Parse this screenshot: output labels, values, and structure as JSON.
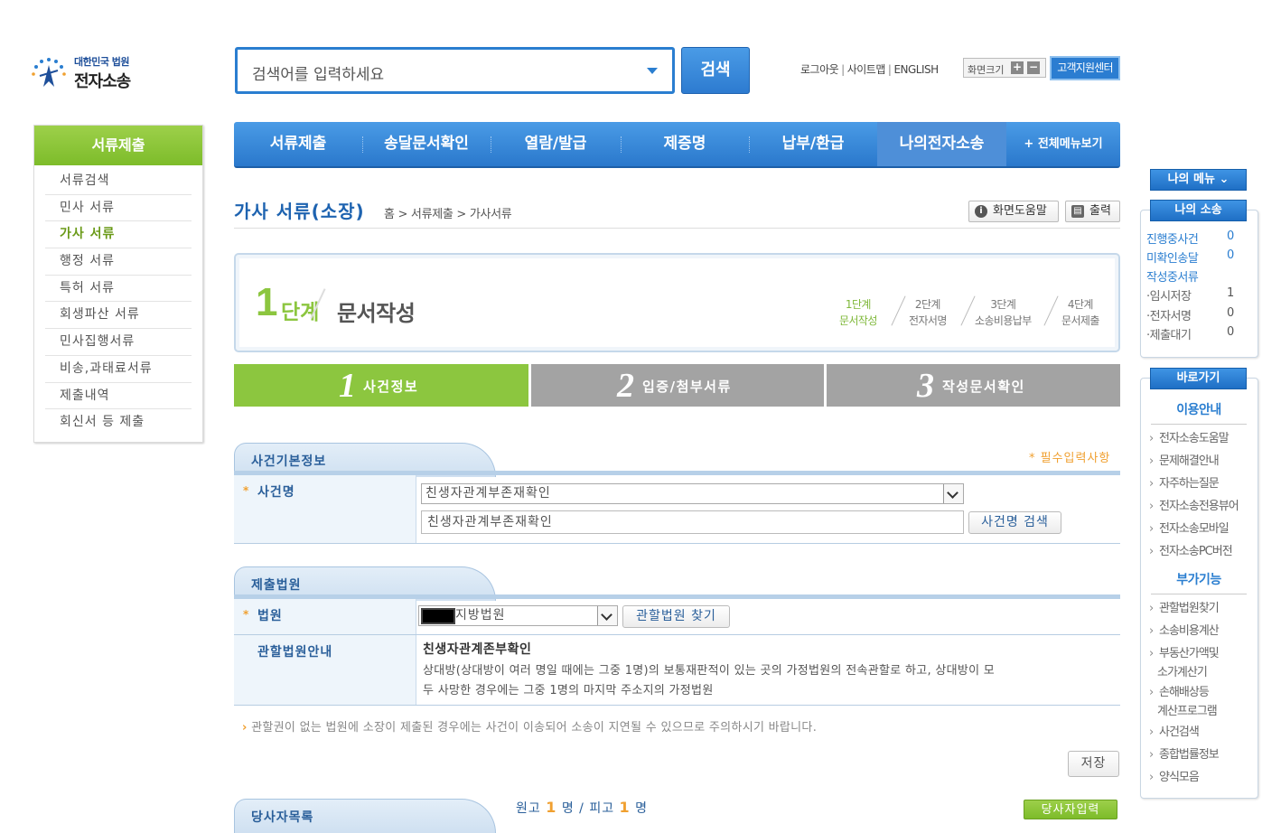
{
  "logo": {
    "line1": "대한민국 법원",
    "line2": "전자소송"
  },
  "search": {
    "placeholder": "검색어를 입력하세요",
    "button": "검색"
  },
  "top_links": {
    "logout": "로그아웃",
    "sitemap": "사이트맵",
    "english": "ENGLISH",
    "zoom_label": "화면크기",
    "zoom_in": "+",
    "zoom_out": "−",
    "customer_center": "고객지원센터"
  },
  "left_menu": {
    "title": "서류제출",
    "items": [
      "서류검색",
      "민사 서류",
      "가사 서류",
      "행정 서류",
      "특허 서류",
      "회생파산 서류",
      "민사집행서류",
      "비송,과태료서류",
      "제출내역",
      "회신서 등 제출"
    ],
    "active_index": 2
  },
  "main_nav": {
    "tabs": [
      "서류제출",
      "송달문서확인",
      "열람/발급",
      "제증명",
      "납부/환급",
      "나의전자소송"
    ],
    "active_index": 5,
    "all_menu": "+ 전체메뉴보기"
  },
  "page": {
    "title": "가사 서류(소장)",
    "breadcrumb": "홈 > 서류제출 > 가사서류",
    "help_button": "화면도움말",
    "print_button": "출력"
  },
  "step_box": {
    "current_num": "1",
    "current_unit": "단계",
    "current_name": "문서작성",
    "steps": [
      {
        "l1": "1단계",
        "l2": "문서작성"
      },
      {
        "l1": "2단계",
        "l2": "전자서명"
      },
      {
        "l1": "3단계",
        "l2": "소송비용납부"
      },
      {
        "l1": "4단계",
        "l2": "문서제출"
      }
    ]
  },
  "wizard_tabs": [
    {
      "num": "1",
      "label": "사건정보",
      "color": "#8cc63f"
    },
    {
      "num": "2",
      "label": "입증/첨부서류",
      "color": "#a3a3a3"
    },
    {
      "num": "3",
      "label": "작성문서확인",
      "color": "#a3a3a3"
    }
  ],
  "case_info": {
    "section_title": "사건기본정보",
    "required_note": "* 필수입력사항",
    "case_name_label": "사건명",
    "case_name_select": "친생자관계부존재확인",
    "case_name_input": "친생자관계부존재확인",
    "case_search_button": "사건명 검색"
  },
  "court": {
    "section_title": "제출법원",
    "court_label": "법원",
    "court_select_suffix": "지방법원",
    "find_button": "관할법원 찾기",
    "guide_label": "관할법원안내",
    "guide_title": "친생자관계존부확인",
    "guide_text_1": "상대방(상대방이 여러 명일 때에는 그중 1명)의 보통재판적이 있는 곳의 가정법원의 전속관할로 하고, 상대방이 모",
    "guide_text_2": "두 사망한 경우에는 그중 1명의 마지막 주소지의 가정법원"
  },
  "notice": "관할권이 없는 법원에 소장이 제출된 경우에는 사건이 이송되어 소송이 지연될 수 있으므로 주의하시기 바랍니다.",
  "save_button": "저장",
  "parties": {
    "section_title": "당사자목록",
    "plaintiff_label": "원고",
    "plaintiff_count": "1",
    "defendant_label": "피고",
    "defendant_count": "1",
    "unit": "명",
    "input_button": "당사자입력"
  },
  "right_panel": {
    "my_menu": "나의 메뉴",
    "my_case": "나의 소송",
    "stats": [
      {
        "label": "진행중사건",
        "value": "0",
        "blue": true
      },
      {
        "label": "미확인송달",
        "value": "0",
        "blue": true
      },
      {
        "label": "작성중서류",
        "value": "",
        "blue": true
      },
      {
        "label": "·임시저장",
        "value": "1",
        "blue": false
      },
      {
        "label": "·전자서명",
        "value": "0",
        "blue": false
      },
      {
        "label": "·제출대기",
        "value": "0",
        "blue": false
      }
    ],
    "shortcut": "바로가기",
    "usage_title": "이용안내",
    "usage_links": [
      "전자소송도움말",
      "문제해결안내",
      "자주하는질문",
      "전자소송전용뷰어",
      "전자소송모바일",
      "전자소송PC버전"
    ],
    "extra_title": "부가기능",
    "extra_links": [
      "관할법원찾기",
      "소송비용계산",
      "부동산가액및",
      "소가계산기",
      "손해배상등",
      "계산프로그램",
      "사건검색",
      "종합법률정보",
      "양식모음"
    ]
  },
  "colors": {
    "brand_blue": "#2a7ed0",
    "brand_green": "#8cc63f",
    "required_orange": "#f0a030"
  }
}
